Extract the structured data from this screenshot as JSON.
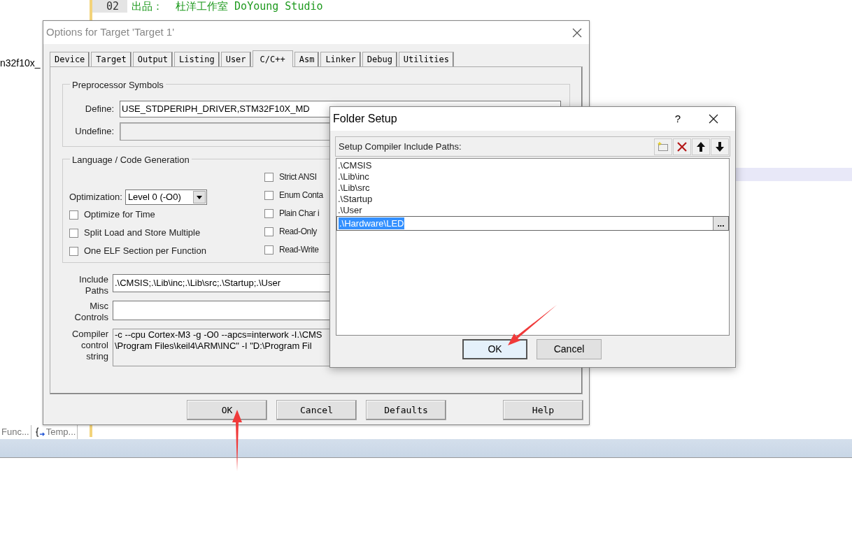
{
  "editor": {
    "lines": [
      {
        "number": "02",
        "text": "出品：  杜洋工作室 DoYoung Studio"
      }
    ],
    "side_text": "n32f10x_",
    "bottom_tabs": [
      {
        "label": "Func...",
        "kind": "plain"
      },
      {
        "label": "Temp...",
        "kind": "template"
      }
    ]
  },
  "options_dialog": {
    "title": "Options for Target 'Target 1'",
    "tabs": [
      {
        "label": "Device",
        "selected": false
      },
      {
        "label": "Target",
        "selected": false
      },
      {
        "label": "Output",
        "selected": false
      },
      {
        "label": "Listing",
        "selected": false
      },
      {
        "label": "User",
        "selected": false
      },
      {
        "label": "C/C++",
        "selected": true
      },
      {
        "label": "Asm",
        "selected": false
      },
      {
        "label": "Linker",
        "selected": false
      },
      {
        "label": "Debug",
        "selected": false
      },
      {
        "label": "Utilities",
        "selected": false
      }
    ],
    "preprocessor": {
      "title": "Preprocessor Symbols",
      "define": {
        "label": "Define:",
        "value": "USE_STDPERIPH_DRIVER,STM32F10X_MD"
      },
      "undefine": {
        "label": "Undefine:"
      }
    },
    "language": {
      "title": "Language / Code Generation",
      "optimization": {
        "label": "Optimization:",
        "value": "Level 0 (-O0)"
      },
      "left_options": [
        {
          "label": "Optimize for Time",
          "checked": false
        },
        {
          "label": "Split Load and Store Multiple",
          "checked": false
        },
        {
          "label": "One ELF Section per Function",
          "checked": false
        }
      ],
      "right_options": [
        {
          "label": "Strict ANSI",
          "checked": false
        },
        {
          "label": "Enum Conta",
          "checked": false
        },
        {
          "label": "Plain Char i",
          "checked": false
        },
        {
          "label": "Read-Only",
          "checked": false
        },
        {
          "label": "Read-Write",
          "checked": false
        }
      ]
    },
    "include_paths": {
      "label": "Include Paths",
      "value": ".\\CMSIS;.\\Lib\\inc;.\\Lib\\src;.\\Startup;.\\User"
    },
    "misc_controls": {
      "label": "Misc Controls"
    },
    "compiler_string": {
      "label": "Compiler control string",
      "lines": [
        "-c --cpu Cortex-M3 -g -O0 --apcs=interwork -I.\\CMS",
        "\\Program Files\\keil4\\ARM\\INC\" -I \"D:\\Program Fil"
      ]
    },
    "buttons": [
      "OK",
      "Cancel",
      "Defaults",
      "Help"
    ]
  },
  "folder_dialog": {
    "title": "Folder Setup",
    "help": "?",
    "header": "Setup Compiler Include Paths:",
    "paths": [
      {
        "text": ".\\CMSIS",
        "editing": false
      },
      {
        "text": ".\\Lib\\inc",
        "editing": false
      },
      {
        "text": ".\\Lib\\src",
        "editing": false
      },
      {
        "text": ".\\Startup",
        "editing": false
      },
      {
        "text": ".\\User",
        "editing": false
      },
      {
        "text": ".\\Hardware\\LED",
        "editing": true
      }
    ],
    "browse": "...",
    "buttons": [
      {
        "label": "OK",
        "focused": true
      },
      {
        "label": "Cancel",
        "focused": false
      }
    ]
  }
}
